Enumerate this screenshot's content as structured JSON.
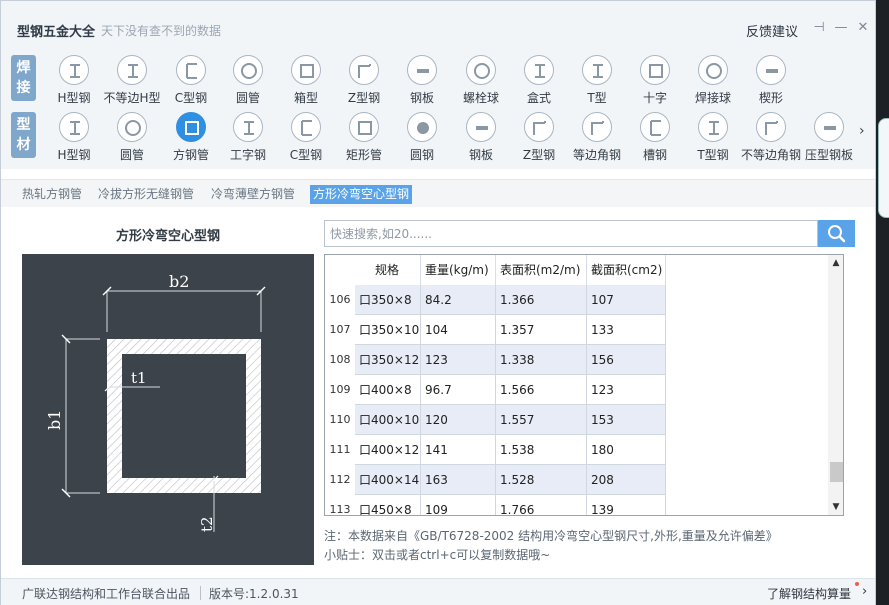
{
  "titlebar": {
    "title": "型钢五金大全",
    "subtitle": "天下没有查不到的数据",
    "feedback": "反馈建议",
    "pin_icon": "⊣",
    "min_icon": "—",
    "close_icon": "✕"
  },
  "categories": {
    "weld_tag": "焊\n接",
    "profile_tag": "型\n材",
    "weld_items": [
      "H型钢",
      "不等边H型",
      "C型钢",
      "圆管",
      "箱型",
      "Z型钢",
      "钢板",
      "螺栓球",
      "盒式",
      "T型",
      "十字",
      "焊接球",
      "楔形"
    ],
    "profile_items": [
      "H型钢",
      "圆管",
      "方钢管",
      "工字钢",
      "C型钢",
      "矩形管",
      "圆钢",
      "钢板",
      "Z型钢",
      "等边角钢",
      "槽钢",
      "T型钢",
      "不等边角钢",
      "压型钢板"
    ],
    "active_profile": "方钢管",
    "more_icon": "›"
  },
  "subtabs": [
    "热轧方钢管",
    "冷拔方形无缝钢管",
    "冷弯薄壁方钢管",
    "方形冷弯空心型钢"
  ],
  "active_subtab": "方形冷弯空心型钢",
  "section": {
    "title": "方形冷弯空心型钢",
    "dim_b2": "b2",
    "dim_b1": "b1",
    "dim_t1": "t1",
    "dim_t2": "t2"
  },
  "search": {
    "placeholder": "快速搜索,如20......",
    "icon": "search-icon"
  },
  "table": {
    "headers": [
      "规格",
      "重量(kg/m)",
      "表面积(m2/m)",
      "截面积(cm2)"
    ],
    "rows": [
      {
        "n": "106",
        "spec": "口350×8",
        "weight": "84.2",
        "surface": "1.366",
        "area": "107"
      },
      {
        "n": "107",
        "spec": "口350×10",
        "weight": "104",
        "surface": "1.357",
        "area": "133"
      },
      {
        "n": "108",
        "spec": "口350×12",
        "weight": "123",
        "surface": "1.338",
        "area": "156"
      },
      {
        "n": "109",
        "spec": "口400×8",
        "weight": "96.7",
        "surface": "1.566",
        "area": "123"
      },
      {
        "n": "110",
        "spec": "口400×10",
        "weight": "120",
        "surface": "1.557",
        "area": "153"
      },
      {
        "n": "111",
        "spec": "口400×12",
        "weight": "141",
        "surface": "1.538",
        "area": "180"
      },
      {
        "n": "112",
        "spec": "口400×14",
        "weight": "163",
        "surface": "1.528",
        "area": "208"
      },
      {
        "n": "113",
        "spec": "口450×8",
        "weight": "109",
        "surface": "1.766",
        "area": "139"
      }
    ]
  },
  "notes": {
    "source": "注：本数据来自《GB/T6728-2002 结构用冷弯空心型钢尺寸,外形,重量及允许偏差》",
    "tip": "小贴士：双击或者ctrl+c可以复制数据哦~"
  },
  "footer": {
    "credit": "广联达钢结构和工作台联合出品",
    "version": "版本号:1.2.0.31",
    "link": "了解钢结构算量",
    "arrow": "›"
  },
  "colors": {
    "accent": "#5aa3e8",
    "active_icon": "#2f8fe0",
    "tag": "#7fa7cb",
    "diagram_bg": "#3d434b",
    "alt_row": "#e7ecf6"
  }
}
